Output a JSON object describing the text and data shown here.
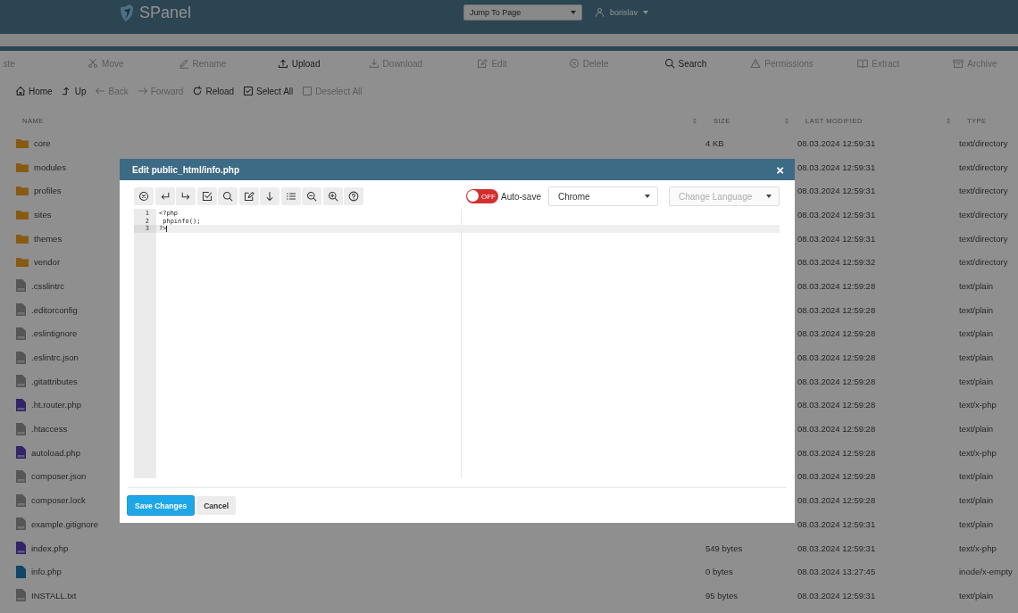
{
  "header": {
    "logo": "SPanel",
    "jump": "Jump To Page",
    "user": "borislav"
  },
  "actions": [
    {
      "label": "ste",
      "disabled": true
    },
    {
      "label": "Move",
      "disabled": true
    },
    {
      "label": "Rename",
      "disabled": true
    },
    {
      "label": "Upload",
      "disabled": false
    },
    {
      "label": "Download",
      "disabled": true
    },
    {
      "label": "Edit",
      "disabled": true
    },
    {
      "label": "Delete",
      "disabled": true
    },
    {
      "label": "Search",
      "disabled": false
    },
    {
      "label": "Permissions",
      "disabled": true
    },
    {
      "label": "Extract",
      "disabled": true
    },
    {
      "label": "Archive",
      "disabled": true
    }
  ],
  "nav": [
    {
      "label": "Home",
      "disabled": false
    },
    {
      "label": "Up",
      "disabled": false
    },
    {
      "label": "Back",
      "disabled": true
    },
    {
      "label": "Forward",
      "disabled": true
    },
    {
      "label": "Reload",
      "disabled": false
    },
    {
      "label": "Select All",
      "disabled": false
    },
    {
      "label": "Deselect All",
      "disabled": true
    }
  ],
  "table": {
    "columns": [
      "NAME",
      "SIZE",
      "LAST MODIFIED",
      "TYPE"
    ],
    "rows": [
      {
        "kind": "folder",
        "name": "core",
        "size": "4 KB",
        "modified": "08.03.2024 12:59:31",
        "type": "text/directory"
      },
      {
        "kind": "folder",
        "name": "modules",
        "modified": "08.03.2024 12:59:31",
        "type": "text/directory"
      },
      {
        "kind": "folder",
        "name": "profiles",
        "modified": "08.03.2024 12:59:31",
        "type": "text/directory"
      },
      {
        "kind": "folder",
        "name": "sites",
        "modified": "08.03.2024 12:59:31",
        "type": "text/directory"
      },
      {
        "kind": "folder",
        "name": "themes",
        "modified": "08.03.2024 12:59:31",
        "type": "text/directory"
      },
      {
        "kind": "folder",
        "name": "vendor",
        "modified": "08.03.2024 12:59:32",
        "type": "text/directory"
      },
      {
        "kind": "text",
        "name": ".csslintrc",
        "modified": "08.03.2024 12:59:28",
        "type": "text/plain"
      },
      {
        "kind": "text",
        "name": ".editorconfig",
        "modified": "08.03.2024 12:59:28",
        "type": "text/plain"
      },
      {
        "kind": "text",
        "name": ".eslintignore",
        "modified": "08.03.2024 12:59:28",
        "type": "text/plain"
      },
      {
        "kind": "text",
        "name": ".eslintrc.json",
        "modified": "08.03.2024 12:59:28",
        "type": "text/plain"
      },
      {
        "kind": "text",
        "name": ".gitattributes",
        "modified": "08.03.2024 12:59:28",
        "type": "text/plain"
      },
      {
        "kind": "php",
        "name": ".ht.router.php",
        "modified": "08.03.2024 12:59:28",
        "type": "text/x-php"
      },
      {
        "kind": "text",
        "name": ".htaccess",
        "modified": "08.03.2024 12:59:28",
        "type": "text/plain"
      },
      {
        "kind": "php",
        "name": "autoload.php",
        "modified": "08.03.2024 12:59:28",
        "type": "text/x-php"
      },
      {
        "kind": "text",
        "name": "composer.json",
        "modified": "08.03.2024 12:59:28",
        "type": "text/plain"
      },
      {
        "kind": "text",
        "name": "composer.lock",
        "modified": "08.03.2024 12:59:28",
        "type": "text/plain"
      },
      {
        "kind": "text",
        "name": "example.gitignore",
        "modified": "08.03.2024 12:59:31",
        "type": "text/plain"
      },
      {
        "kind": "php",
        "name": "index.php",
        "size": "549 bytes",
        "modified": "08.03.2024 12:59:31",
        "type": "text/x-php"
      },
      {
        "kind": "empty",
        "name": "info.php",
        "size": "0 bytes",
        "modified": "08.03.2024 13:27:45",
        "type": "inode/x-empty"
      },
      {
        "kind": "text",
        "name": "INSTALL.txt",
        "size": "95 bytes",
        "modified": "08.03.2024 12:59:31",
        "type": "text/plain"
      }
    ]
  },
  "dialog": {
    "title": "Edit public_html/info.php",
    "close": "×",
    "autosave": {
      "label": "Auto-save",
      "on": false,
      "state": "OFF"
    },
    "theme": "Chrome",
    "language": {
      "placeholder": "Change Language"
    },
    "lines": [
      {
        "number": "1",
        "code": "<?php",
        "active": false
      },
      {
        "number": "2",
        "code": " phpinfo();",
        "active": false
      },
      {
        "number": "3",
        "code": "?>",
        "active": true
      }
    ],
    "buttons": [
      {
        "label": "Save Changes",
        "kind": "primary"
      },
      {
        "label": "Cancel",
        "kind": "secondary"
      }
    ]
  }
}
